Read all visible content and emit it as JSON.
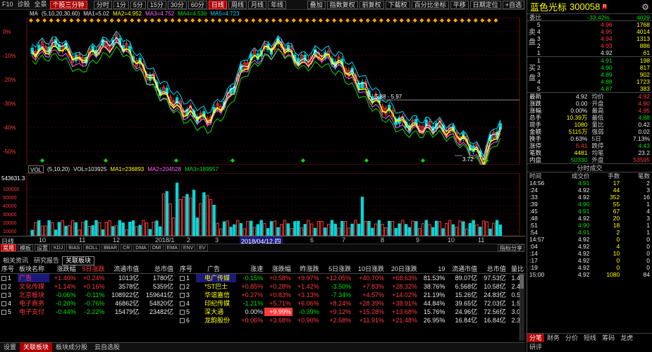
{
  "toolbar": {
    "items": [
      "F10",
      "诊股",
      "全景"
    ],
    "active": "个股三分钟",
    "periods": [
      "分时",
      "1分",
      "5分",
      "15分",
      "30分",
      "60分",
      "日线",
      "周线",
      "月线",
      "年线"
    ],
    "active_period": "日线",
    "right": [
      "叠加",
      "指数复权",
      "前复权",
      "下载权",
      "百分比坐标",
      "平移",
      "日期定位",
      "+自选"
    ]
  },
  "ma_line": {
    "label": "MA",
    "params": "(5,10,20,30,60)",
    "ma1": "MA1=5.02",
    "ma2": "MA2=4.952",
    "ma3": "MA3=4.752",
    "ma4": "MA4=4.536",
    "ma5": "MA5=4.723"
  },
  "chart_data": {
    "type": "candlestick",
    "y_ticks": [
      "0%",
      "-10%",
      "-20%",
      "-30%",
      "-40%",
      "-50%"
    ],
    "annotations": [
      "5.88 - 5.97",
      "3.72"
    ]
  },
  "vol_line": {
    "label": "VOL",
    "params": "(5,10,20)",
    "vol": "VOL=103925",
    "ma1": "MA1=236893",
    "ma2": "MA2=204528",
    "ma3": "MA3=189957"
  },
  "vol_axis": {
    "top": "543631.3",
    "ticks": [
      "100000",
      "50000",
      "40000",
      "30000",
      "20000",
      "10000"
    ]
  },
  "x_axis": {
    "labels": [
      "日线",
      "10",
      "11",
      "12",
      "2018/1",
      "2",
      "3",
      "2018/04/12,四",
      "6",
      "7",
      "8",
      "9",
      "10",
      "11"
    ]
  },
  "indicator_tabs": [
    "常用",
    "模板",
    "设置",
    "KDJ",
    "BIAS",
    "BOLL",
    "BBAR",
    "CR",
    "DMA",
    "DMI",
    "EMA",
    "ENV",
    "EV"
  ],
  "indicator_right": "指标分享",
  "bottom_tabs": [
    "相关资讯",
    "研究报告",
    "关联板块"
  ],
  "plate": {
    "headers": [
      "序号",
      "板块名称",
      "涨跌幅",
      "5日涨跌",
      "流通市值",
      "总市值"
    ],
    "rows": [
      {
        "no": "1",
        "name": "广告",
        "chg": "+1.40%",
        "d5": "+0.24%",
        "float": "1013亿",
        "total": "1780亿"
      },
      {
        "no": "2",
        "name": "文化传媒",
        "chg": "+1.14%",
        "d5": "+0.16%",
        "float": "3578亿",
        "total": "5359亿"
      },
      {
        "no": "3",
        "name": "北京板块",
        "chg": "-0.06%",
        "d5": "-0.11%",
        "float": "108922亿",
        "total": "159641亿"
      },
      {
        "no": "4",
        "name": "电子商务",
        "chg": "-0.20%",
        "d5": "-0.76%",
        "float": "46862亿",
        "total": "54820亿"
      },
      {
        "no": "5",
        "name": "电子支付",
        "chg": "-0.44%",
        "d5": "-2.22%",
        "float": "15479亿",
        "total": "23482亿"
      }
    ]
  },
  "stocks": {
    "headers": [
      "序号",
      "广告",
      "涨速",
      "涨跌幅",
      "昨涨跌",
      "5日涨跌",
      "10日涨跌",
      "20日涨跌",
      "19",
      "流通市值",
      "总市值",
      "量比"
    ],
    "rows": [
      {
        "no": "1",
        "name": "电广传媒",
        "spd": "-0.15%",
        "chg": "+0.58%",
        "y": "+9.97%",
        "d5": "+12.05%",
        "d10": "+40.70%",
        "d20": "+68.63%",
        "c19": "81.53%",
        "float": "89.07亿",
        "total": "97.53亿",
        "vr": "1.41"
      },
      {
        "no": "2",
        "name": "*ST巴士",
        "spd": "+0.85%",
        "chg": "+0.28%",
        "y": "+1.42%",
        "d5": "-3.50%",
        "d10": "+7.83%",
        "d20": "+28.32%",
        "c19": "38.76%",
        "float": "6.568亿",
        "total": "10.58亿",
        "vr": "2.45"
      },
      {
        "no": "3",
        "name": "华谊嘉信",
        "spd": "+0.27%",
        "chg": "+0.83%",
        "y": "+3.13%",
        "d5": "-7.34%",
        "d10": "+4.57%",
        "d20": "+14.02%",
        "c19": "21.19%",
        "float": "15.26亿",
        "total": "24.83亿",
        "vr": "0.57"
      },
      {
        "no": "4",
        "name": "印纪传媒",
        "spd": "-1.21%",
        "chg": "+5.71%",
        "y": "+6.06%",
        "d5": "+8.24%",
        "d10": "+28.39%",
        "d20": "+38.91%",
        "c19": "44.84%",
        "float": "39.65亿",
        "total": "72.03亿",
        "vr": "1.56"
      },
      {
        "no": "5",
        "name": "深大通",
        "spd": "0.00%",
        "chg": "+9.99%",
        "y": "-0.39%",
        "d5": "+9.12%",
        "d10": "+15.28%",
        "d20": "+13.68%",
        "c19": "15.76%",
        "float": "24.96亿",
        "total": "72.56亿",
        "vr": "3.04"
      },
      {
        "no": "6",
        "name": "龙韵股份",
        "spd": "+0.06%",
        "chg": "+3.68%",
        "y": "+0.90%",
        "d5": "+2.68%",
        "d10": "+11.91%",
        "d20": "+21.48%",
        "c19": "26.95%",
        "float": "16.84亿",
        "total": "16.84亿",
        "vr": "2.30"
      }
    ]
  },
  "status": [
    "设置",
    "关联板块",
    "板块成分股",
    "云自选股"
  ],
  "quote": {
    "name": "蓝色光标",
    "code": "300058",
    "badge": "R",
    "webi": "委比",
    "webi_val": "-33.42%",
    "webi_diff": "4029",
    "sell": [
      {
        "lv": "5",
        "p": "4.96",
        "v": "1768"
      },
      {
        "lv": "4",
        "p": "4.95",
        "v": "4014"
      },
      {
        "lv": "3",
        "p": "4.94",
        "v": "1313"
      },
      {
        "lv": "2",
        "p": "4.93",
        "v": "886"
      },
      {
        "lv": "1",
        "p": "4.92",
        "v": "61"
      }
    ],
    "buy": [
      {
        "lv": "1",
        "p": "4.91",
        "v": "198"
      },
      {
        "lv": "2",
        "p": "4.90",
        "v": "817"
      },
      {
        "lv": "3",
        "p": "4.89",
        "v": "902"
      },
      {
        "lv": "4",
        "p": "4.88",
        "v": "1723"
      },
      {
        "lv": "5",
        "p": "4.87",
        "v": "383"
      }
    ],
    "sell_label": "卖盘",
    "buy_label": "买盘",
    "stats": [
      [
        "最新",
        "4.92",
        "均价",
        "4.92"
      ],
      [
        "涨跌",
        "0.00",
        "开盘",
        "4.90"
      ],
      [
        "涨幅",
        "0.00%",
        "最高",
        "4.95"
      ],
      [
        "总手",
        "10.39万",
        "最低",
        "4.88"
      ],
      [
        "现手",
        "1080",
        "量比",
        "0.42"
      ],
      [
        "金额",
        "5115万",
        "强弱",
        "0.02"
      ],
      [
        "换手",
        "0.63%",
        "5日",
        "7.13%"
      ],
      [
        "涨停",
        "5.41",
        "跌停",
        "4.43"
      ],
      [
        "笔数",
        "4481",
        "均笔",
        "23.2"
      ],
      [
        "内盘",
        "50330",
        "外盘",
        "53595"
      ]
    ],
    "ticks_title": "分时成交",
    "ticks_headers": [
      "时间",
      "成交价",
      "手数",
      "笔数"
    ],
    "ticks": [
      [
        "14:56",
        "4.91",
        "17",
        "2"
      ],
      [
        ":24",
        "4.92",
        "44",
        "3"
      ],
      [
        ":33",
        "4.92",
        "352",
        "16"
      ],
      [
        ":39",
        "4.90",
        "55",
        "1"
      ],
      [
        ":45",
        "4.91",
        "67",
        "4"
      ],
      [
        ":48",
        "4.92",
        "20",
        "3"
      ],
      [
        ":51",
        "4.90",
        "18",
        "1"
      ],
      [
        ":54",
        "4.91",
        "2",
        "1"
      ],
      [
        "14:57",
        "4.92",
        "0",
        "0"
      ],
      [
        ":04",
        "4.92",
        "4",
        "0"
      ],
      [
        ":14",
        "4.92",
        "10",
        "0"
      ],
      [
        ":17",
        "4.92",
        "0",
        "0"
      ],
      [
        ":19",
        "4.92",
        "0",
        "0"
      ],
      [
        "15:00",
        "4.92",
        "1080",
        "84"
      ]
    ],
    "tabs": [
      "分笔",
      "财务",
      "分价",
      "短线",
      "筹码",
      "龙虎"
    ],
    "bottom": "研评"
  }
}
